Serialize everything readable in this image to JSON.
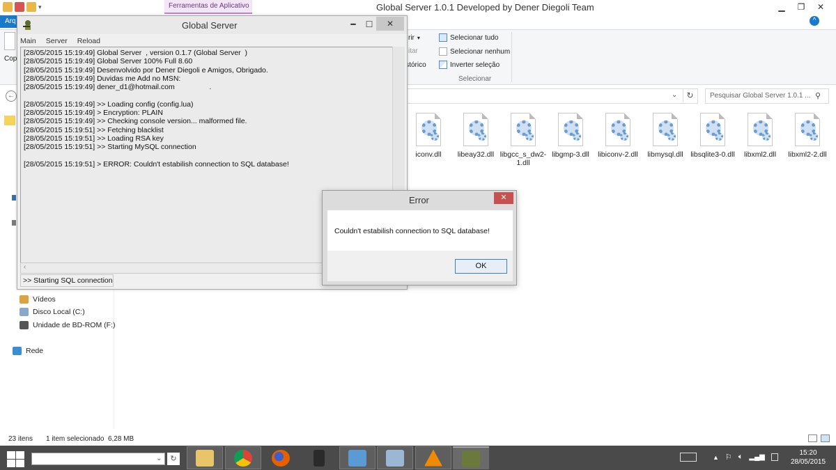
{
  "explorer": {
    "window_title": "Global Server 1.0.1 Developed by Dener Diegoli Team",
    "context_tab": "Ferramentas de Aplicativo",
    "arq_tab": "Arq",
    "cop_label": "Cop",
    "ribbon": {
      "frag1": "rir",
      "frag2": "itar",
      "frag3": "istórico",
      "select_all": "Selecionar tudo",
      "select_none": "Selecionar nenhum",
      "invert": "Inverter seleção",
      "group_label": "Selecionar"
    },
    "search_placeholder": "Pesquisar Global Server 1.0.1 ...",
    "files": [
      "iconv.dll",
      "libeay32.dll",
      "libgcc_s_dw2-1.dll",
      "libgmp-3.dll",
      "libiconv-2.dll",
      "libmysql.dll",
      "libsqlite3-0.dll",
      "libxml2.dll",
      "libxml2-2.dll"
    ],
    "nav": {
      "videos": "Vídeos",
      "local_disk": "Disco Local (C:)",
      "bdrom": "Unidade de BD-ROM (F:)",
      "network": "Rede"
    },
    "status": {
      "count": "23 itens",
      "selection": "1 item selecionado  6,28 MB"
    }
  },
  "console": {
    "title": "Global Server",
    "menu": [
      "Main",
      "Server",
      "Reload"
    ],
    "log": "[28/05/2015 15:19:49] Global Server  , version 0.1.7 (Global Server  )\n[28/05/2015 15:19:49] Global Server 100% Full 8.60\n[28/05/2015 15:19:49] Desenvolvido por Dener Diegoli e Amigos, Obrigado.\n[28/05/2015 15:19:49] Duvidas me Add no MSN:\n[28/05/2015 15:19:49] dener_d1@hotmail.com                 .\n\n[28/05/2015 15:19:49] >> Loading config (config.lua)\n[28/05/2015 15:19:49] > Encryption: PLAIN\n[28/05/2015 15:19:49] >> Checking console version... malformed file.\n[28/05/2015 15:19:51] >> Fetching blacklist\n[28/05/2015 15:19:51] >> Loading RSA key\n[28/05/2015 15:19:51] >> Starting MySQL connection\n\n[28/05/2015 15:19:51] > ERROR: Couldn't estabilish connection to SQL database!",
    "status": ">> Starting SQL connection"
  },
  "error_dialog": {
    "title": "Error",
    "message": "Couldn't estabilish connection to SQL database!",
    "ok_label": "OK"
  },
  "taskbar": {
    "clock_time": "15:20",
    "clock_date": "28/05/2015"
  },
  "colors": {
    "accent": "#1979ca",
    "taskbar": "#4a4a4a",
    "close_red": "#c75050"
  }
}
